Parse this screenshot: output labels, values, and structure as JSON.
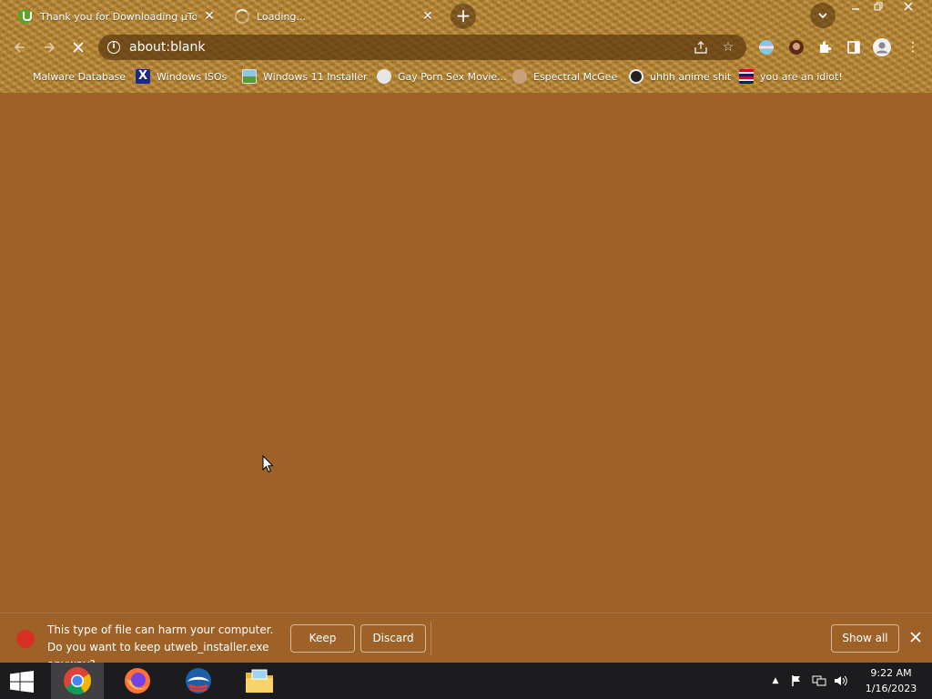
{
  "tabs": [
    {
      "title": "Thank you for Downloading µTorrent",
      "favicon": "utorrent-icon",
      "active": true
    },
    {
      "title": "Loading...",
      "favicon": "loading-spinner-icon",
      "active": false
    }
  ],
  "omnibox": {
    "url": "about:blank"
  },
  "bookmarks": [
    {
      "label": "Malware Database",
      "icon": "bookmark-icon"
    },
    {
      "label": "Windows ISOs",
      "icon": "x-icon"
    },
    {
      "label": "Windows 11 Installer",
      "icon": "image-icon"
    },
    {
      "label": "Gay Porn Sex Movie...",
      "icon": "site-icon"
    },
    {
      "label": "Espectral McGee",
      "icon": "face-icon"
    },
    {
      "label": "uhhh anime shit",
      "icon": "anime-icon"
    },
    {
      "label": "you are an idiot!",
      "icon": "flag-icon"
    }
  ],
  "download_shelf": {
    "warning": "This type of file can harm your computer. Do you want to keep utweb_installer.exe anyway?",
    "keep_label": "Keep",
    "discard_label": "Discard",
    "show_all_label": "Show all"
  },
  "taskbar": {
    "apps": [
      "chrome-icon",
      "firefox-icon",
      "edge-icon",
      "file-explorer-icon"
    ],
    "clock_time": "9:22 AM",
    "clock_date": "1/16/2023"
  },
  "colors": {
    "content_bg": "#9e6228",
    "taskbar_bg": "#1c1c1e",
    "warning_red": "#d93025"
  }
}
